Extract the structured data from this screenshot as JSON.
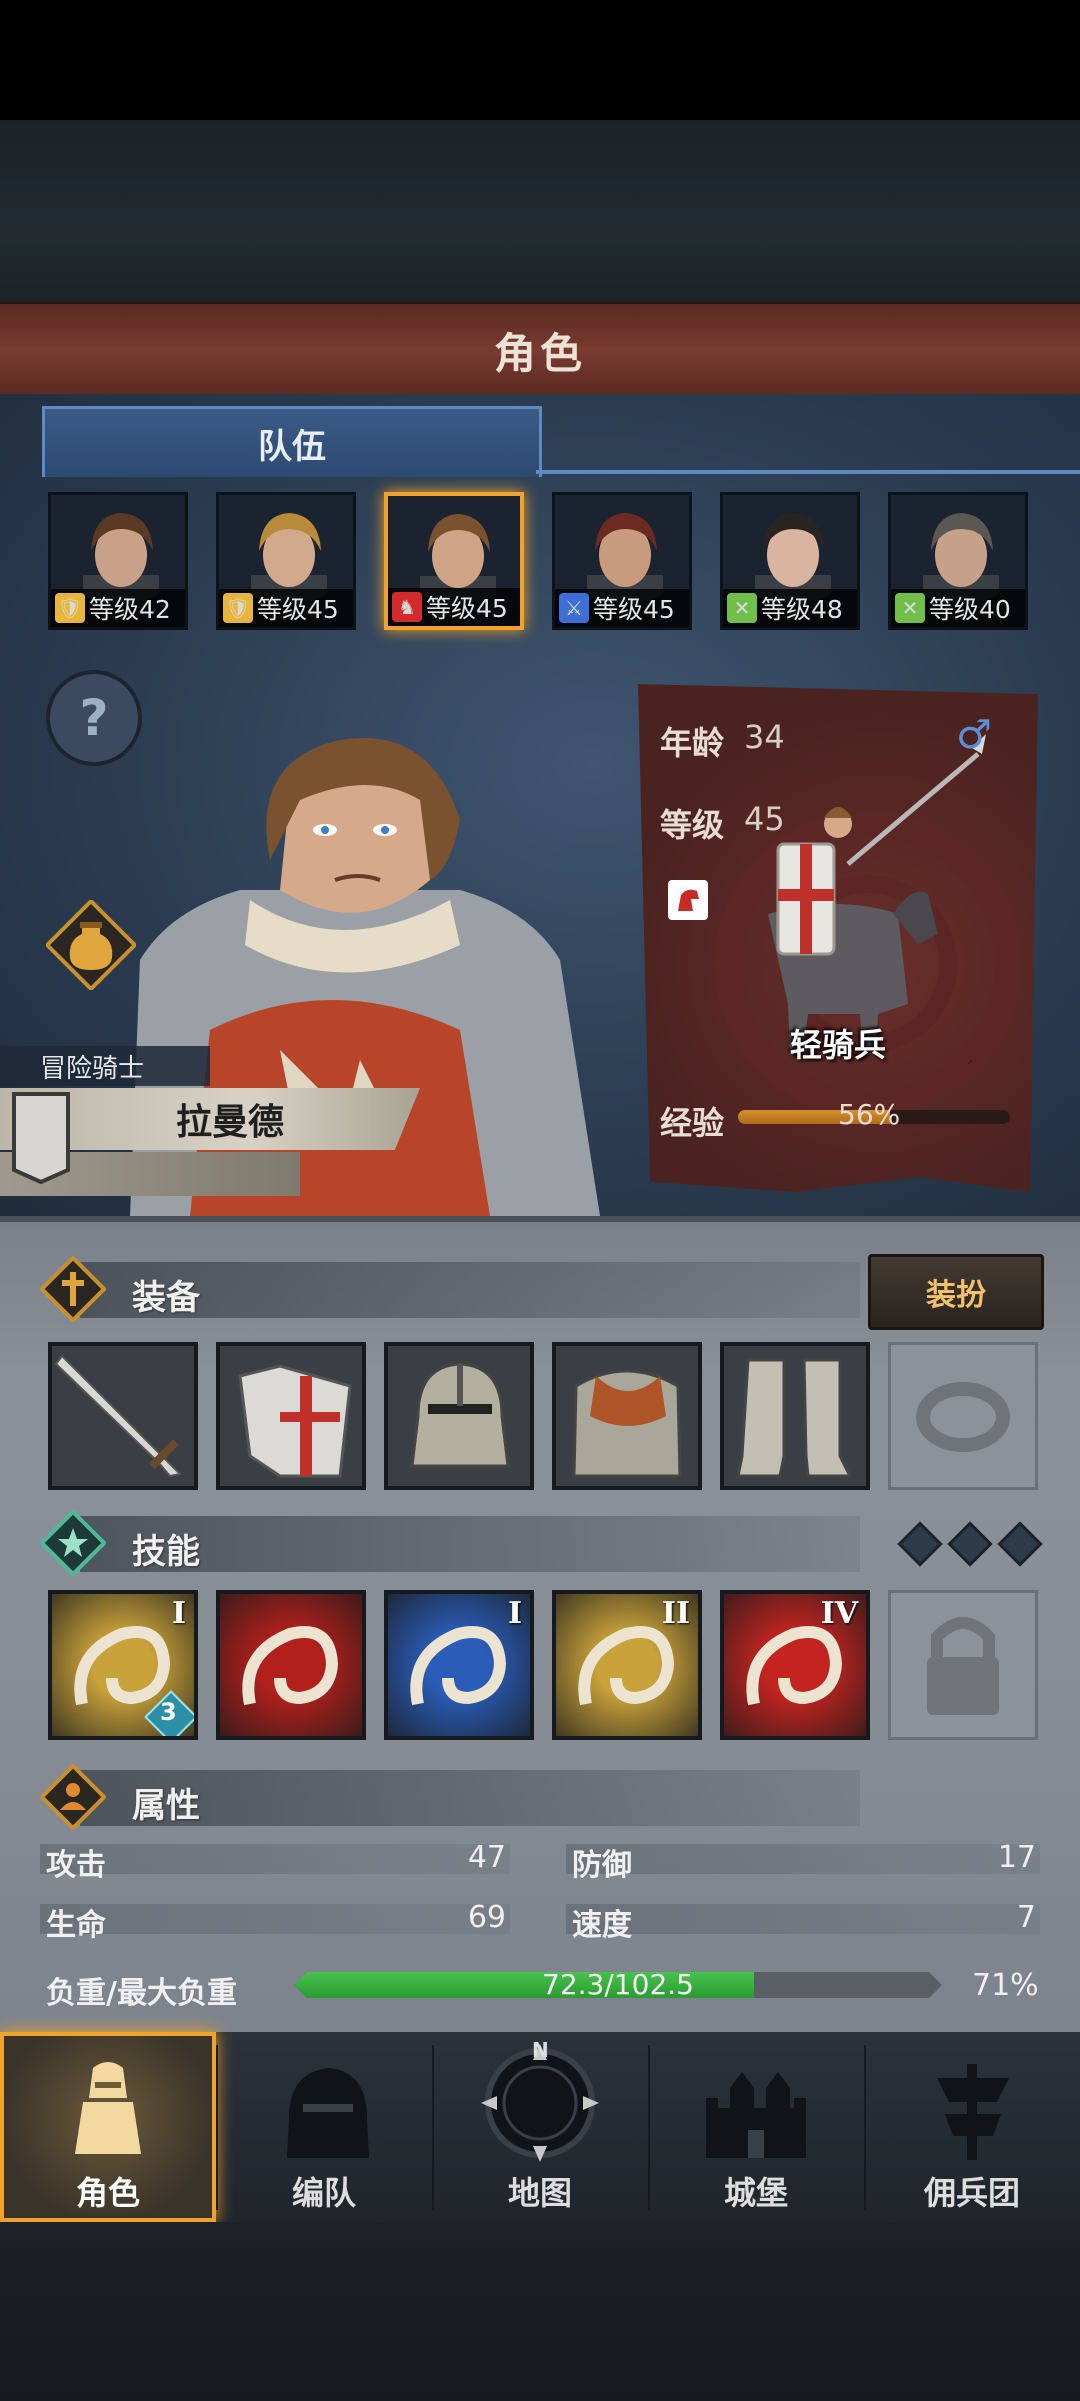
{
  "title": "角色",
  "tab": "队伍",
  "roster": [
    {
      "class_icon": "shield-icon",
      "class_color": "#e7b53a",
      "level": "等级42",
      "hair": "#5a3a24",
      "skin": "#c9a188",
      "selected": false
    },
    {
      "class_icon": "shield-icon",
      "class_color": "#e7b53a",
      "level": "等级45",
      "hair": "#b98a3a",
      "skin": "#d1a98c",
      "selected": false
    },
    {
      "class_icon": "horse-icon",
      "class_color": "#d32b2b",
      "level": "等级45",
      "hair": "#7a5230",
      "skin": "#cfa486",
      "selected": true
    },
    {
      "class_icon": "sword-icon",
      "class_color": "#3d6fd6",
      "level": "等级45",
      "hair": "#6b2a22",
      "skin": "#c89a7e",
      "selected": false
    },
    {
      "class_icon": "bow-icon",
      "class_color": "#6fbf4a",
      "level": "等级48",
      "hair": "#2a2420",
      "skin": "#d9b4a0",
      "selected": false
    },
    {
      "class_icon": "bow-icon",
      "class_color": "#6fbf4a",
      "level": "等级40",
      "hair": "#5b5752",
      "skin": "#c7a08a",
      "selected": false
    }
  ],
  "hero": {
    "class_title": "冒险骑士",
    "name": "拉曼德",
    "age_label": "年龄",
    "age": "34",
    "level_label": "等级",
    "level": "45",
    "unit": "轻骑兵",
    "xp_label": "经验",
    "xp_text": "56%",
    "xp_fraction": 0.56
  },
  "equipment": {
    "title": "装备",
    "dress_button": "装扮",
    "slots": [
      "sword",
      "tabard-shield",
      "helmet",
      "armor",
      "boots",
      "ring-empty"
    ]
  },
  "skills": {
    "title": "技能",
    "items": [
      {
        "icon": "whirlwind-icon",
        "bg": "#c9a23a",
        "rank": "I",
        "badge": "3"
      },
      {
        "icon": "punch-icon",
        "bg": "#b3201c",
        "rank": "",
        "badge": ""
      },
      {
        "icon": "parry-icon",
        "bg": "#2a5cb8",
        "rank": "I",
        "badge": ""
      },
      {
        "icon": "shield-skill-icon",
        "bg": "#c9a23a",
        "rank": "II",
        "badge": ""
      },
      {
        "icon": "sword-skill-icon",
        "bg": "#c42420",
        "rank": "IV",
        "badge": ""
      }
    ]
  },
  "attributes": {
    "title": "属性",
    "attack_label": "攻击",
    "attack": "47",
    "defense_label": "防御",
    "defense": "17",
    "hp_label": "生命",
    "hp": "69",
    "speed_label": "速度",
    "speed": "7",
    "load_label": "负重/最大负重",
    "load_text": "72.3/102.5",
    "load_fraction": 0.71,
    "load_percent": "71%"
  },
  "nav": [
    {
      "label": "角色",
      "icon": "knight-icon",
      "active": true
    },
    {
      "label": "编队",
      "icon": "helmet-icon",
      "active": false
    },
    {
      "label": "地图",
      "icon": "compass-icon",
      "active": false
    },
    {
      "label": "城堡",
      "icon": "castle-icon",
      "active": false
    },
    {
      "label": "佣兵团",
      "icon": "banner-icon",
      "active": false
    }
  ],
  "compass_n": "N"
}
